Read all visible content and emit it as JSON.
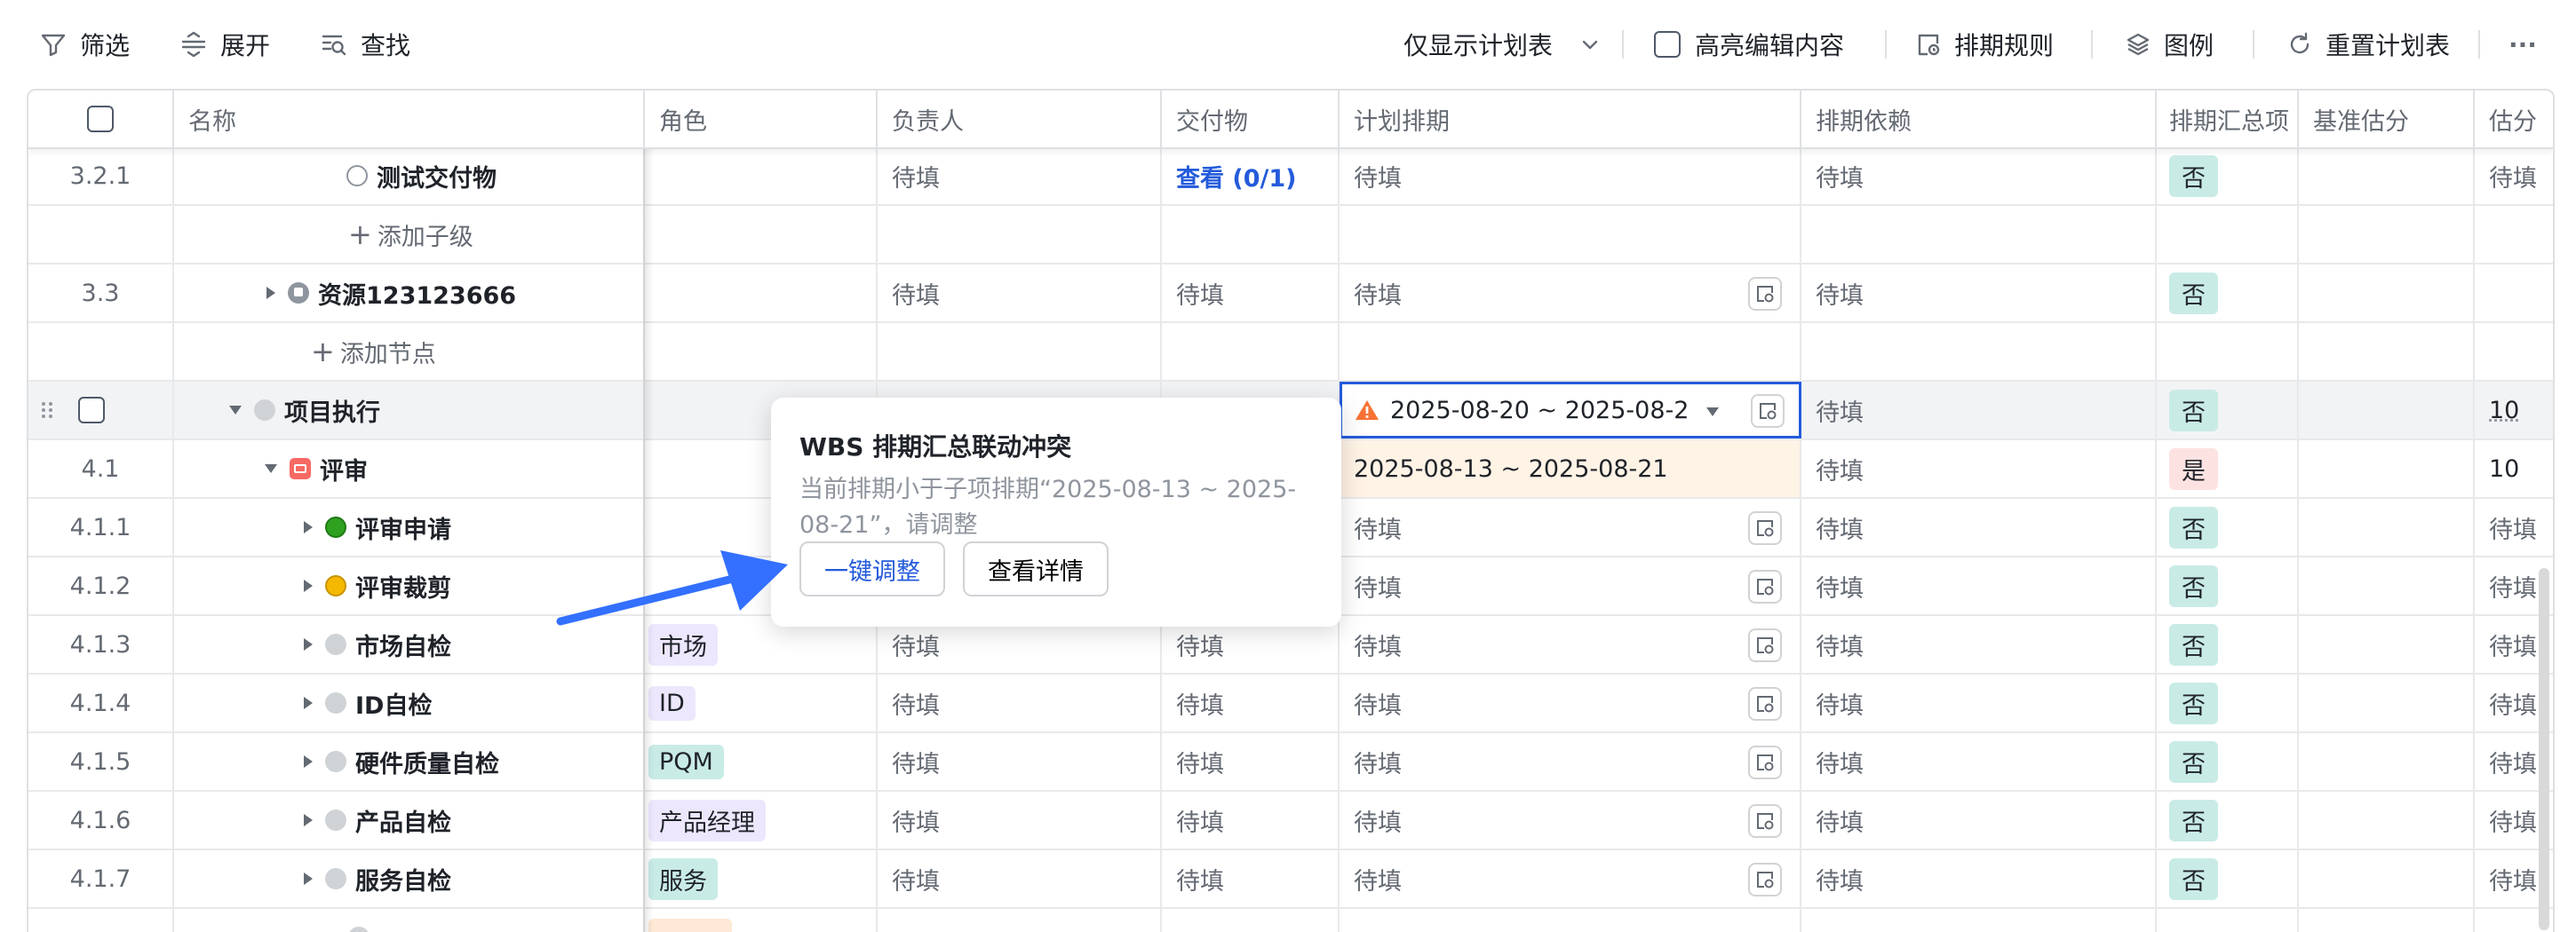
{
  "toolbar": {
    "filter": "筛选",
    "expand": "展开",
    "find": "查找",
    "view_select": "仅显示计划表",
    "highlight": "高亮编辑内容",
    "rules": "排期规则",
    "legend": "图例",
    "reset": "重置计划表",
    "more": "···"
  },
  "columns": {
    "name": "名称",
    "role": "角色",
    "owner": "负责人",
    "deliverable": "交付物",
    "plan": "计划排期",
    "dependency": "排期依赖",
    "summary": "排期汇总项",
    "baseline": "基准估分",
    "estimate": "估分"
  },
  "rows": [
    {
      "num": "3.2.1",
      "name": "测试交付物",
      "owner": "待填",
      "deliverable": "查看 (0/1)",
      "plan": "待填",
      "dependency": "待填",
      "summary": "否",
      "estimate": "待填"
    },
    {
      "add": "添加子级"
    },
    {
      "num": "3.3",
      "name": "资源123123666",
      "owner": "待填",
      "deliverable": "待填",
      "plan": "待填",
      "dependency": "待填",
      "summary": "否",
      "estimate": ""
    },
    {
      "add": "添加节点"
    },
    {
      "num": "",
      "name": "项目执行",
      "plan": "2025-08-20 ~ 2025-08-2",
      "dependency": "待填",
      "summary": "否",
      "estimate": "10"
    },
    {
      "num": "4.1",
      "name": "评审",
      "plan": "2025-08-13 ~ 2025-08-21",
      "dependency": "待填",
      "summary": "是",
      "estimate": "10"
    },
    {
      "num": "4.1.1",
      "name": "评审申请",
      "plan": "待填",
      "dependency": "待填",
      "summary": "否",
      "estimate": "待填"
    },
    {
      "num": "4.1.2",
      "name": "评审裁剪",
      "plan": "待填",
      "dependency": "待填",
      "summary": "否",
      "estimate": "待填"
    },
    {
      "num": "4.1.3",
      "name": "市场自检",
      "role": "市场",
      "owner": "待填",
      "deliverable": "待填",
      "plan": "待填",
      "dependency": "待填",
      "summary": "否",
      "estimate": "待填"
    },
    {
      "num": "4.1.4",
      "name": "ID自检",
      "role": "ID",
      "owner": "待填",
      "deliverable": "待填",
      "plan": "待填",
      "dependency": "待填",
      "summary": "否",
      "estimate": "待填"
    },
    {
      "num": "4.1.5",
      "name": "硬件质量自检",
      "role": "PQM",
      "owner": "待填",
      "deliverable": "待填",
      "plan": "待填",
      "dependency": "待填",
      "summary": "否",
      "estimate": "待填"
    },
    {
      "num": "4.1.6",
      "name": "产品自检",
      "role": "产品经理",
      "owner": "待填",
      "deliverable": "待填",
      "plan": "待填",
      "dependency": "待填",
      "summary": "否",
      "estimate": "待填"
    },
    {
      "num": "4.1.7",
      "name": "服务自检",
      "role": "服务",
      "owner": "待填",
      "deliverable": "待填",
      "plan": "待填",
      "dependency": "待填",
      "summary": "否",
      "estimate": "待填"
    }
  ],
  "popup": {
    "title": "WBS 排期汇总联动冲突",
    "message": "当前排期小于子项排期“2025-08-13 ~ 2025-08-21”，请调整",
    "adjust": "一键调整",
    "details": "查看详情"
  },
  "colors": {
    "accent": "#245bdb",
    "no_tag": "#c9ebe6",
    "yes_tag": "#fde2e2",
    "warning": "#f77234",
    "status_green": "#2ea121",
    "status_yellow": "#f5b800",
    "review_icon": "#f76964"
  }
}
